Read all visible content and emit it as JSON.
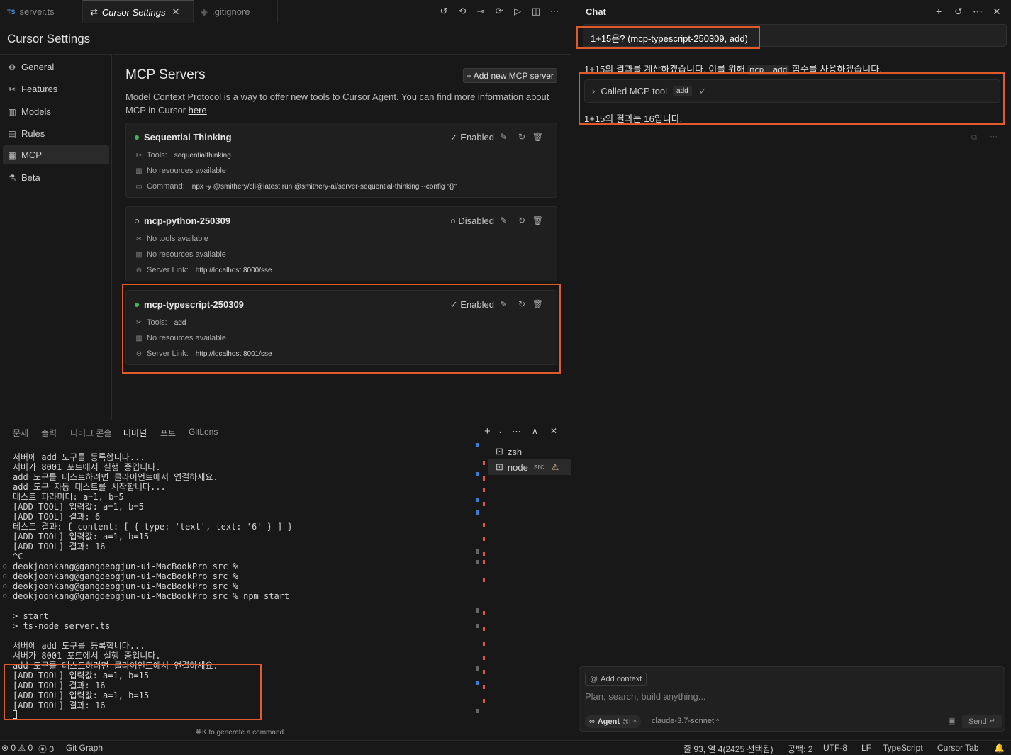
{
  "tabs": [
    {
      "label": "server.ts",
      "badge": "TS"
    },
    {
      "label": "Cursor Settings"
    },
    {
      "label": ".gitignore"
    }
  ],
  "settings": {
    "title": "Cursor Settings",
    "nav": [
      "General",
      "Features",
      "Models",
      "Rules",
      "MCP",
      "Beta"
    ],
    "selected": "MCP"
  },
  "mcp": {
    "heading": "MCP Servers",
    "add_button": "+ Add new MCP server",
    "description": "Model Context Protocol is a way to offer new tools to Cursor Agent. You can find more information about MCP in Cursor",
    "link": "here",
    "servers": [
      {
        "name": "Sequential Thinking",
        "status": "Enabled",
        "tools_label": "Tools:",
        "tools": "sequentialthinking",
        "resources": "No resources available",
        "extra_label": "Command:",
        "extra_value": "npx -y @smithery/cli@latest run @smithery-ai/server-sequential-thinking --config \"{}\""
      },
      {
        "name": "mcp-python-250309",
        "status": "Disabled",
        "tools_label": "No tools available",
        "resources": "No resources available",
        "extra_label": "Server Link:",
        "extra_value": "http://localhost:8000/sse"
      },
      {
        "name": "mcp-typescript-250309",
        "status": "Enabled",
        "tools_label": "Tools:",
        "tools": "add",
        "resources": "No resources available",
        "extra_label": "Server Link:",
        "extra_value": "http://localhost:8001/sse"
      }
    ]
  },
  "panel": {
    "tabs": [
      "문제",
      "출력",
      "디버그 콘솔",
      "터미널",
      "포트",
      "GitLens"
    ],
    "selected": "터미널",
    "terminals": [
      {
        "name": "zsh"
      },
      {
        "name": "node",
        "sub": "src"
      }
    ],
    "hint": "⌘K to generate a command"
  },
  "terminal": {
    "lines": [
      "서버에 add 도구를 등록합니다...",
      "서버가 8001 포트에서 실행 중입니다.",
      "add 도구를 테스트하려면 클라이언트에서 연결하세요.",
      "add 도구 자동 테스트를 시작합니다...",
      "테스트 파라미터: a=1, b=5",
      "[ADD TOOL] 입력값: a=1, b=5",
      "[ADD TOOL] 결과: 6",
      "테스트 결과: { content: [ { type: 'text', text: '6' } ] }",
      "[ADD TOOL] 입력값: a=1, b=15",
      "[ADD TOOL] 결과: 16",
      "^C",
      "deokjoonkang@gangdeogjun-ui-MacBookPro src %",
      "deokjoonkang@gangdeogjun-ui-MacBookPro src %",
      "deokjoonkang@gangdeogjun-ui-MacBookPro src %",
      "deokjoonkang@gangdeogjun-ui-MacBookPro src % npm start",
      "",
      "> start",
      "> ts-node server.ts",
      "",
      "서버에 add 도구를 등록합니다...",
      "서버가 8001 포트에서 실행 중입니다.",
      "add 도구를 테스트하려면 클라이언트에서 연결하세요.",
      "[ADD TOOL] 입력값: a=1, b=15",
      "[ADD TOOL] 결과: 16",
      "[ADD TOOL] 입력값: a=1, b=15",
      "[ADD TOOL] 결과: 16"
    ]
  },
  "chat": {
    "title": "Chat",
    "user_message": "1+15은? (mcp-typescript-250309, add)",
    "assistant_1_pre": "1+15의 결과를 계산하겠습니다. 이를 위해",
    "assistant_1_code": "mcp__add",
    "assistant_1_post": "함수를 사용하겠습니다.",
    "tool_call_label": "Called MCP tool",
    "tool_call_name": "add",
    "assistant_2": "1+15의 결과는 16입니다.",
    "add_context": "Add context",
    "placeholder": "Plan, search, build anything...",
    "mode": "Agent",
    "mode_shortcut": "⌘I",
    "model": "claude-3.7-sonnet",
    "send": "Send"
  },
  "statusbar": {
    "errors": "0",
    "warnings": "0",
    "ports": "0",
    "git_graph": "Git Graph",
    "position": "줄 93, 열 4(2425 선택됨)",
    "spaces": "공백: 2",
    "encoding": "UTF-8",
    "eol": "LF",
    "language": "TypeScript",
    "cursor_tab": "Cursor Tab"
  },
  "colors": {
    "enabled_dot": "#3fb950",
    "highlight_box": "#e05a2b",
    "background": "#181818"
  }
}
